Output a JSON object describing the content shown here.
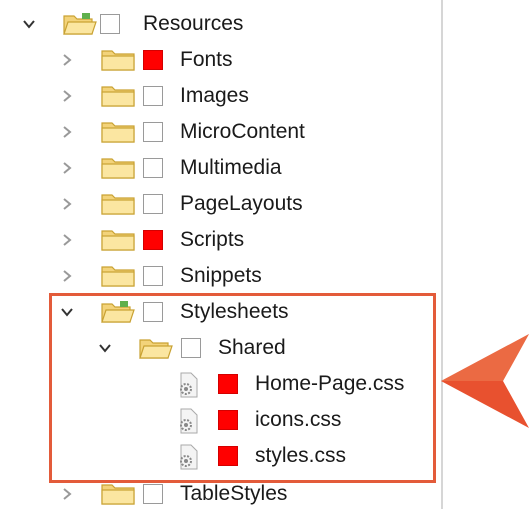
{
  "tree": {
    "root": {
      "label": "Resources",
      "expanded": true,
      "color": "white"
    },
    "folders": [
      {
        "label": "Fonts",
        "color": "red"
      },
      {
        "label": "Images",
        "color": "white"
      },
      {
        "label": "MicroContent",
        "color": "white"
      },
      {
        "label": "Multimedia",
        "color": "white"
      },
      {
        "label": "PageLayouts",
        "color": "white"
      },
      {
        "label": "Scripts",
        "color": "red"
      },
      {
        "label": "Snippets",
        "color": "white"
      },
      {
        "label": "Stylesheets",
        "color": "white",
        "expanded": true
      },
      {
        "label": "TableStyles",
        "color": "white"
      }
    ],
    "subfolder": {
      "label": "Shared",
      "color": "white",
      "expanded": true
    },
    "files": [
      {
        "label": "Home-Page.css",
        "color": "red"
      },
      {
        "label": "icons.css",
        "color": "red"
      },
      {
        "label": "styles.css",
        "color": "red"
      }
    ]
  },
  "colors": {
    "red_box": "#ff0000",
    "highlight": "#e35b3a",
    "arrow": "#e8512f"
  },
  "icons": {
    "expanded": "chevron-down-icon",
    "collapsed": "chevron-right-icon",
    "folder": "folder-icon",
    "open_folder": "folder-open-icon",
    "css_file": "gear-file-icon"
  }
}
